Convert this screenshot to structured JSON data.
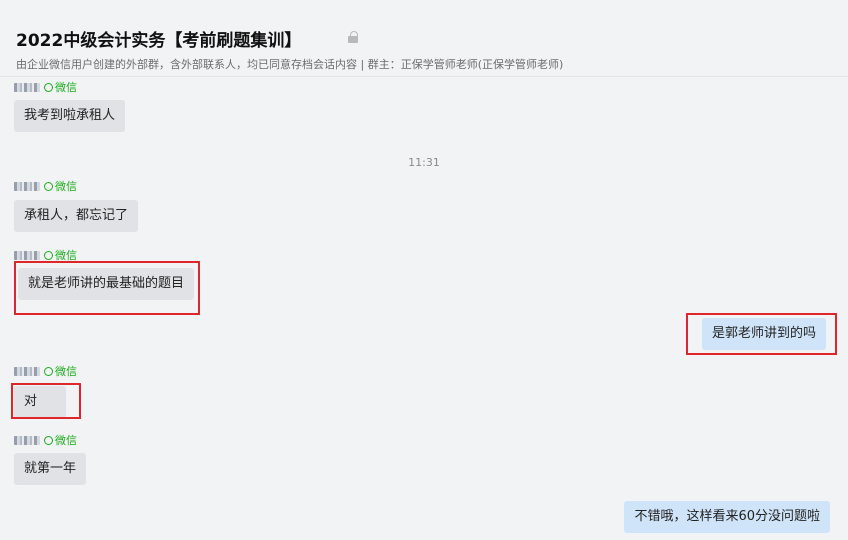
{
  "header": {
    "title": "2022中级会计实务【考前刷题集训】",
    "subtitle": "由企业微信用户创建的外部群，含外部联系人，均已同意存档会话内容 | 群主：正保学管师老师(正保学管师老师)"
  },
  "timestamp": "11:31",
  "messages": [
    {
      "sender_tag": "微信",
      "text": "我考到啦承租人"
    },
    {
      "sender_tag": "微信",
      "text": "承租人，都忘记了"
    },
    {
      "sender_tag": "微信",
      "text": "就是老师讲的最基础的题目"
    },
    {
      "text": "是郭老师讲到的吗"
    },
    {
      "sender_tag": "微信",
      "text": "对"
    },
    {
      "sender_tag": "微信",
      "text": "就第一年"
    },
    {
      "text": "不错哦，这样看来60分没问题啦"
    }
  ],
  "colors": {
    "highlight_box": "#e0262b",
    "wechat_tag": "#1aad19",
    "right_bubble": "#cfe4f8",
    "left_bubble": "#e1e2e6"
  }
}
